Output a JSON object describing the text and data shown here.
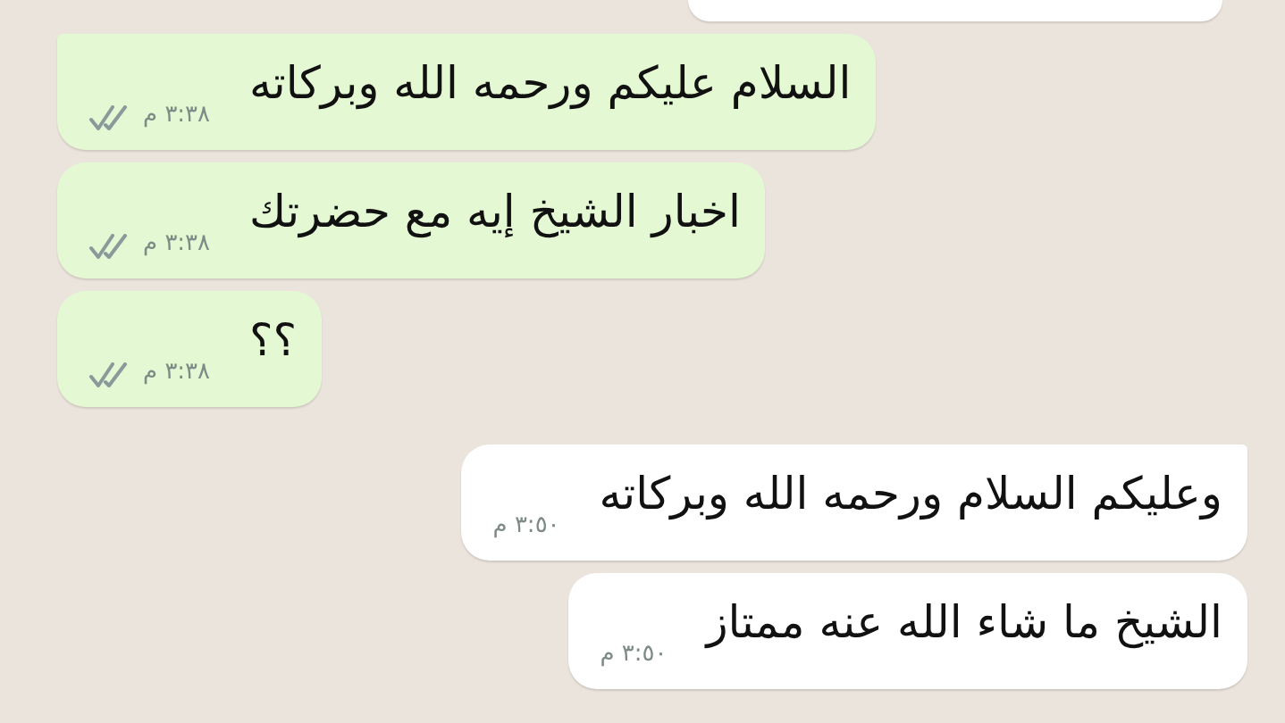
{
  "messages": [
    {
      "kind": "cut"
    },
    {
      "kind": "outgoing",
      "text": "السلام عليكم ورحمه الله وبركاته",
      "time": "٣:٣٨ م",
      "delivered": true
    },
    {
      "kind": "outgoing",
      "text": "اخبار الشيخ إيه مع حضرتك",
      "time": "٣:٣٨ م",
      "delivered": true
    },
    {
      "kind": "outgoing",
      "text": "؟؟",
      "time": "٣:٣٨ م",
      "delivered": true
    },
    {
      "kind": "incoming",
      "text": "وعليكم السلام ورحمه الله وبركاته",
      "time": "٣:٥٠ م"
    },
    {
      "kind": "incoming",
      "text": "الشيخ ما شاء الله عنه ممتاز",
      "time": "٣:٥٠ م"
    }
  ]
}
